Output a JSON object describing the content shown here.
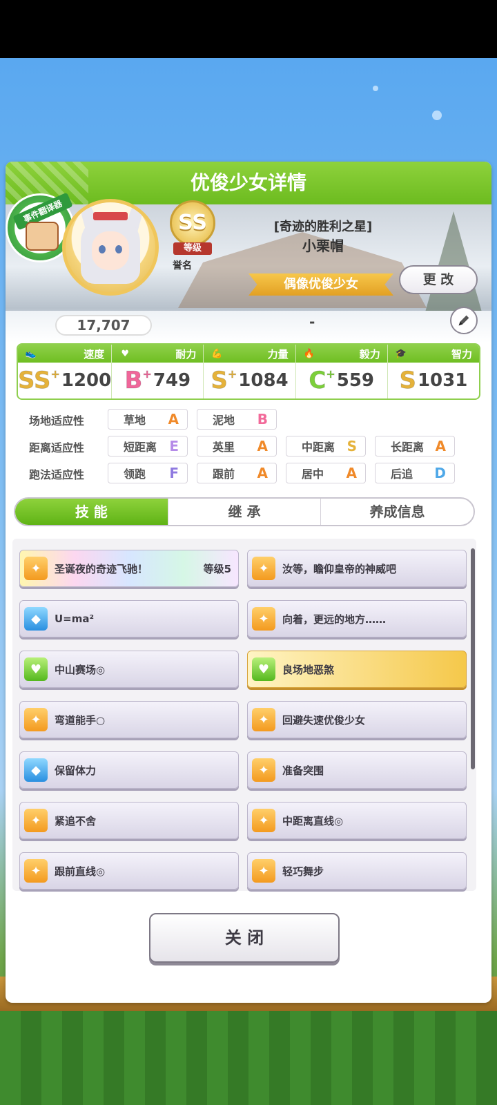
{
  "header": {
    "title": "优俊少女详情"
  },
  "badge": {
    "label": "事件翻译器"
  },
  "profile": {
    "fans": "17,707",
    "rank_letters": "SS",
    "rank_label": "等级",
    "honor_label": "誉名",
    "epithet": "[奇迹的胜利之星]",
    "name": "小栗帽",
    "title_banner": "偶像优俊少女",
    "change_button": "更 改",
    "note": "-"
  },
  "stats": [
    {
      "name": "速度",
      "icon": "shoe-icon",
      "grade": "SS",
      "plus": "+",
      "value": "1200",
      "color": "#e5b23a"
    },
    {
      "name": "耐力",
      "icon": "heart-icon",
      "grade": "B",
      "plus": "+",
      "value": "749",
      "color": "#f0669a"
    },
    {
      "name": "力量",
      "icon": "muscle-icon",
      "grade": "S",
      "plus": "+",
      "value": "1084",
      "color": "#e5b23a"
    },
    {
      "name": "毅力",
      "icon": "flame-icon",
      "grade": "C",
      "plus": "+",
      "value": "559",
      "color": "#7ccf3a"
    },
    {
      "name": "智力",
      "icon": "graduation-cap-icon",
      "grade": "S",
      "plus": "",
      "value": "1031",
      "color": "#e5b23a"
    }
  ],
  "aptitude": {
    "surface": {
      "label": "场地适应性",
      "items": [
        {
          "name": "草地",
          "grade": "A"
        },
        {
          "name": "泥地",
          "grade": "B"
        }
      ]
    },
    "distance": {
      "label": "距离适应性",
      "items": [
        {
          "name": "短距离",
          "grade": "E"
        },
        {
          "name": "英里",
          "grade": "A"
        },
        {
          "name": "中距离",
          "grade": "S"
        },
        {
          "name": "长距离",
          "grade": "A"
        }
      ]
    },
    "strategy": {
      "label": "跑法适应性",
      "items": [
        {
          "name": "领跑",
          "grade": "F"
        },
        {
          "name": "跟前",
          "grade": "A"
        },
        {
          "name": "居中",
          "grade": "A"
        },
        {
          "name": "后追",
          "grade": "D"
        }
      ]
    },
    "grade_colors": {
      "A": "#f08a2a",
      "B": "#f26a9a",
      "E": "#b58be8",
      "F": "#8f7ae0",
      "S": "#e5b23a",
      "D": "#4fa8e8"
    }
  },
  "tabs": {
    "skills": "技 能",
    "inherit": "继 承",
    "training": "养成信息"
  },
  "skills": [
    {
      "name": "圣诞夜的奇迹飞驰！",
      "level": "等级5",
      "icon": "orange"
    },
    {
      "name": "汝等，瞻仰皇帝的神威吧",
      "icon": "orange"
    },
    {
      "name": "U=ma²",
      "icon": "blue"
    },
    {
      "name": "向着，更远的地方……",
      "icon": "orange"
    },
    {
      "name": "中山赛场◎",
      "icon": "green"
    },
    {
      "name": "良场地恶煞",
      "icon": "green"
    },
    {
      "name": "弯道能手○",
      "icon": "orange"
    },
    {
      "name": "回避失速优俊少女",
      "icon": "orange"
    },
    {
      "name": "保留体力",
      "icon": "blue"
    },
    {
      "name": "准备突围",
      "icon": "orange"
    },
    {
      "name": "紧追不舍",
      "icon": "orange"
    },
    {
      "name": "中距离直线◎",
      "icon": "orange"
    },
    {
      "name": "跟前直线◎",
      "icon": "orange"
    },
    {
      "name": "轻巧舞步",
      "icon": "orange"
    }
  ],
  "close_button": "关 闭"
}
